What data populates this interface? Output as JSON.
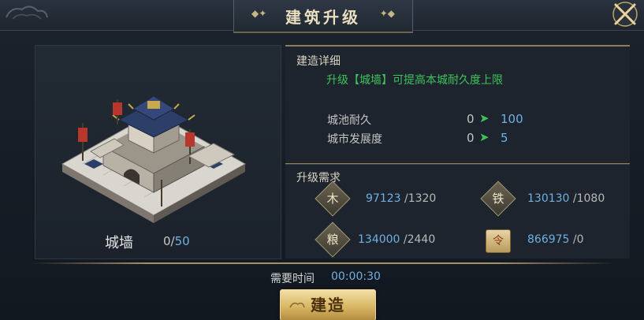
{
  "title": "建筑升级",
  "building": {
    "name": "城墙",
    "count_current": "0",
    "count_sep": "/",
    "count_max": "50"
  },
  "details": {
    "section_label": "建造详细",
    "description": "升级【城墙】可提高本城耐久度上限",
    "stats": [
      {
        "label": "城池耐久",
        "current": "0",
        "next": "100"
      },
      {
        "label": "城市发展度",
        "current": "0",
        "next": "5"
      }
    ],
    "arrow_glyph": "➤"
  },
  "requirements": {
    "section_label": "升级需求",
    "items": [
      {
        "icon": "wood-icon",
        "glyph": "木",
        "have": "97123",
        "need": " /1320"
      },
      {
        "icon": "iron-icon",
        "glyph": "铁",
        "have": "130130",
        "need": " /1080"
      },
      {
        "icon": "grain-icon",
        "glyph": "粮",
        "have": "134000",
        "need": " /2440"
      },
      {
        "icon": "scroll-icon",
        "glyph": "令",
        "have": "866975",
        "need": " /0"
      }
    ]
  },
  "footer": {
    "time_label": "需要时间",
    "time_value": "00:00:30",
    "build_button": "建造"
  },
  "colors": {
    "accent_blue": "#6fb1e2",
    "accent_green": "#3ec25a",
    "gold": "#d8b766"
  }
}
